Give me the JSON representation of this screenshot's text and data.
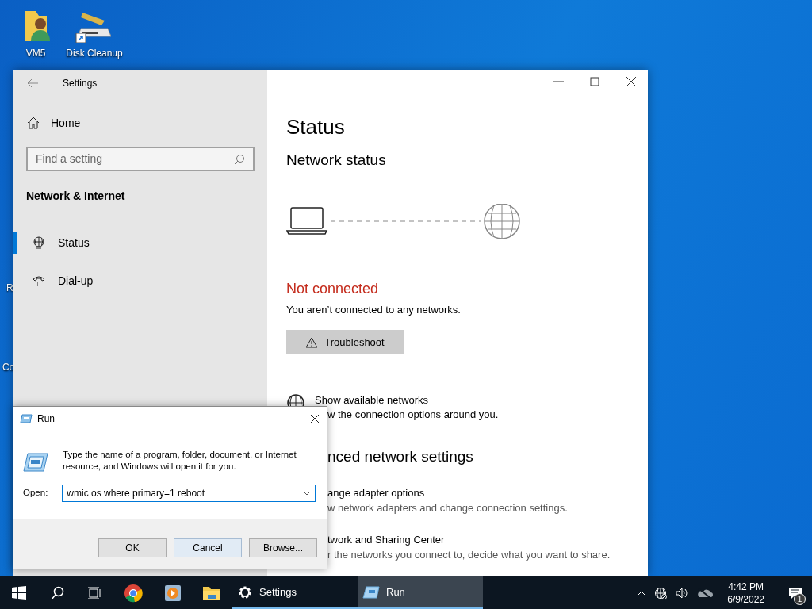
{
  "desktop_icons": [
    {
      "label": "VM5",
      "kind": "user-folder"
    },
    {
      "label": "Disk Cleanup",
      "kind": "cleanup"
    }
  ],
  "desktop_partial_labels": [
    "R",
    "Co"
  ],
  "settings": {
    "title": "Settings",
    "home": "Home",
    "search": {
      "placeholder": "Find a setting"
    },
    "section": "Network & Internet",
    "nav_items": [
      {
        "label": "Status",
        "kind": "globe",
        "selected": true
      },
      {
        "label": "Dial-up",
        "kind": "phone",
        "selected": false
      }
    ],
    "page_title": "Status",
    "subtitle": "Network status",
    "connection_status": "Not connected",
    "connection_detail": "You aren’t connected to any networks.",
    "troubleshoot": "Troubleshoot",
    "show_networks": {
      "title": "Show available networks",
      "description": "w the connection options around you."
    },
    "advanced_heading": "nced network settings",
    "advanced_links": [
      {
        "title": "ange adapter options",
        "description": "w network adapters and change connection settings."
      },
      {
        "title": "twork and Sharing Center",
        "description": "r the networks you connect to, decide what you want to share."
      }
    ]
  },
  "run": {
    "title": "Run",
    "prompt": "Type the name of a program, folder, document, or Internet resource, and Windows will open it for you.",
    "open_label": "Open:",
    "value": "wmic os where primary=1 reboot",
    "buttons": [
      {
        "label": "OK",
        "focused": false
      },
      {
        "label": "Cancel",
        "focused": true
      },
      {
        "label": "Browse...",
        "focused": false
      }
    ]
  },
  "taskbar": {
    "pinned": [
      {
        "kind": "start"
      },
      {
        "kind": "search"
      },
      {
        "kind": "task-view"
      },
      {
        "kind": "chrome"
      },
      {
        "kind": "media"
      },
      {
        "kind": "explorer"
      }
    ],
    "windows": [
      {
        "label": "Settings",
        "kind": "gear",
        "active": false
      },
      {
        "label": "Run",
        "kind": "run",
        "active": true
      }
    ],
    "time": "4:42 PM",
    "date": "6/9/2022",
    "notification_count": "1"
  }
}
